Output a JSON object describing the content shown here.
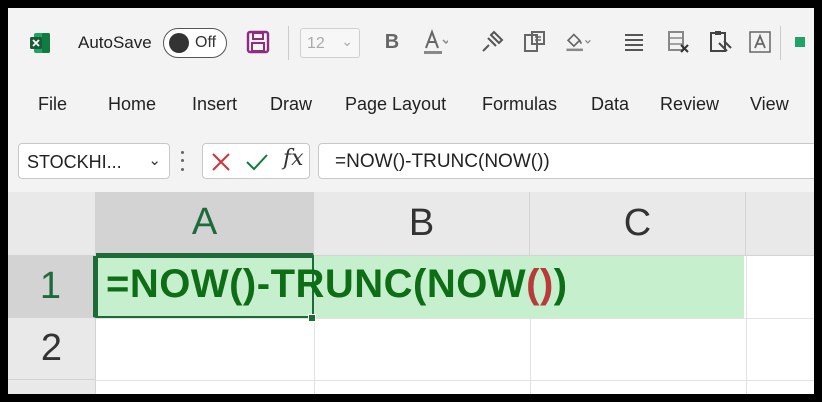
{
  "qat": {
    "autosave_label": "AutoSave",
    "autosave_state": "Off",
    "font_size": "12",
    "icons": [
      "excel-logo-icon",
      "save-icon",
      "bold-icon",
      "font-color-icon",
      "format-painter-icon",
      "paste-special-icon",
      "fill-color-icon",
      "align-icon",
      "clear-icon",
      "paste-values-icon",
      "text-box-icon"
    ]
  },
  "ribbon": {
    "tabs": [
      "File",
      "Home",
      "Insert",
      "Draw",
      "Page Layout",
      "Formulas",
      "Data",
      "Review",
      "View"
    ]
  },
  "formula_bar": {
    "name_box": "STOCKHI...",
    "formula": "=NOW()-TRUNC(NOW())"
  },
  "grid": {
    "columns": [
      "A",
      "B",
      "C"
    ],
    "rows": [
      "1",
      "2"
    ],
    "cell_a1": {
      "prefix": "=NOW()-TRUNC(NOW",
      "paren_highlight": "()",
      "suffix": ")"
    }
  },
  "colors": {
    "excel_green": "#1e6b3a",
    "formula_green": "#0d6e15",
    "highlight_fill": "#c6efce",
    "paren_red": "#b83b3b"
  }
}
